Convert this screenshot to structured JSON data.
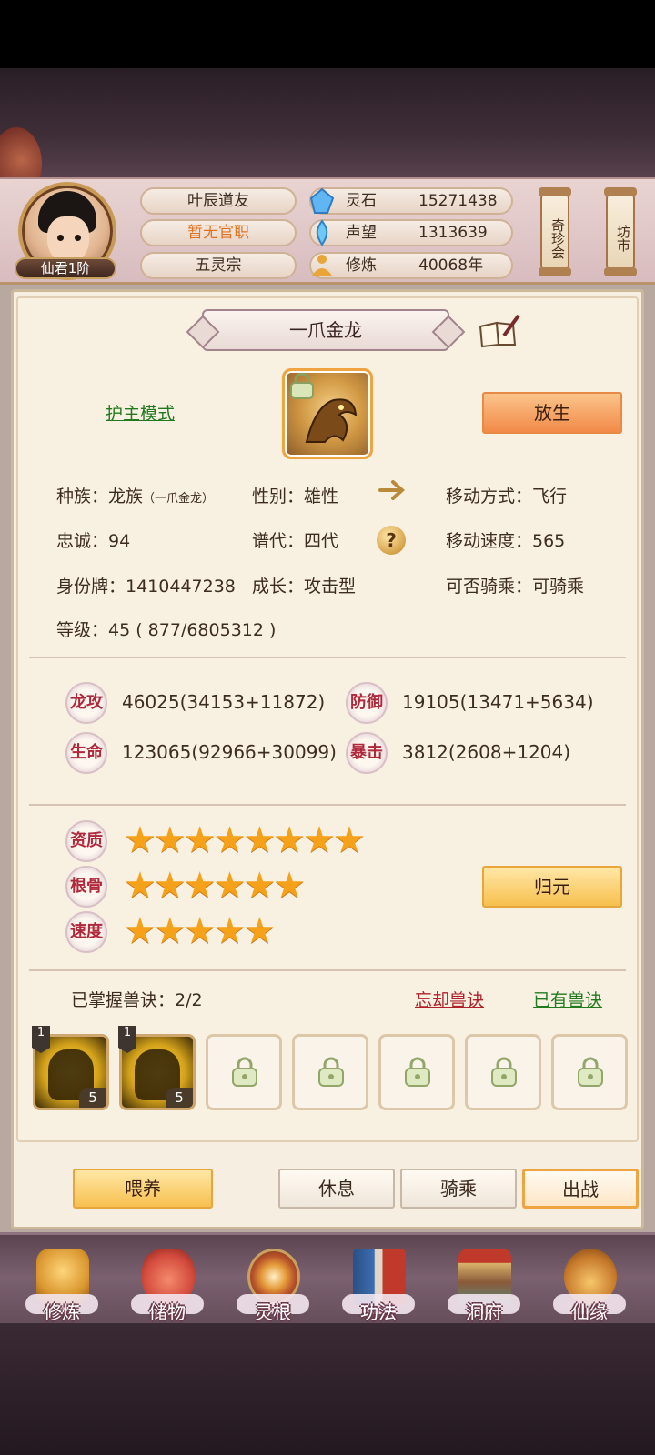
{
  "header": {
    "player_name": "叶辰道友",
    "official_post": "暂无官职",
    "sect": "五灵宗",
    "rank": "仙君1阶",
    "resources": [
      {
        "label": "灵石",
        "value": "15271438",
        "icon": "spirit-stone-icon"
      },
      {
        "label": "声望",
        "value": "1313639",
        "icon": "reputation-icon"
      },
      {
        "label": "修炼",
        "value": "40068年",
        "icon": "meditation-icon"
      }
    ],
    "hanging_signs": [
      "奇珍会",
      "坊市"
    ]
  },
  "pet": {
    "name": "一爪金龙",
    "mode_link": "护主模式",
    "release_button": "放生",
    "info": {
      "race": "种族：龙族",
      "race_sub": "（一爪金龙）",
      "gender": "性别：雄性",
      "movement": "移动方式：飞行",
      "loyalty": "忠诚：94",
      "generation": "谱代：四代",
      "move_speed": "移动速度：565",
      "id_tag": "身份牌：1410447238",
      "growth": "成长：攻击型",
      "rideable": "可否骑乘：可骑乘",
      "level": "等级：45 ( 877/6805312 )"
    },
    "stats": [
      {
        "label": "龙攻",
        "value": "46025(34153+11872)"
      },
      {
        "label": "防御",
        "value": "19105(13471+5634)"
      },
      {
        "label": "生命",
        "value": "123065(92966+30099)"
      },
      {
        "label": "暴击",
        "value": "3812(2608+1204)"
      }
    ],
    "ratings": [
      {
        "label": "资质",
        "stars": "★★★★★★★★",
        "count": 8
      },
      {
        "label": "根骨",
        "stars": "★★★★★★",
        "count": 6
      },
      {
        "label": "速度",
        "stars": "★★★★★",
        "count": 5
      }
    ],
    "return_button": "归元",
    "skills_text": "已掌握兽诀：2/2",
    "forget_link": "忘却兽诀",
    "owned_link": "已有兽诀",
    "skill_slots": [
      {
        "filled": true,
        "level": "1",
        "count": "5"
      },
      {
        "filled": true,
        "level": "1",
        "count": "5"
      },
      {
        "filled": false
      },
      {
        "filled": false
      },
      {
        "filled": false
      },
      {
        "filled": false
      },
      {
        "filled": false
      }
    ]
  },
  "actions": {
    "feed": "喂养",
    "rest": "休息",
    "ride": "骑乘",
    "battle": "出战"
  },
  "nav": [
    {
      "label": "修炼",
      "icon": "cultivation-icon",
      "color": "#d9962f"
    },
    {
      "label": "储物",
      "icon": "storage-bag-icon",
      "color": "#d24a3c"
    },
    {
      "label": "灵根",
      "icon": "spirit-root-icon",
      "color": "#b8532a"
    },
    {
      "label": "功法",
      "icon": "technique-book-icon",
      "color": "#3b6fb0"
    },
    {
      "label": "洞府",
      "icon": "cave-mansion-icon",
      "color": "#8a5a3a"
    },
    {
      "label": "仙缘",
      "icon": "immortal-fate-icon",
      "color": "#c5782a"
    }
  ]
}
